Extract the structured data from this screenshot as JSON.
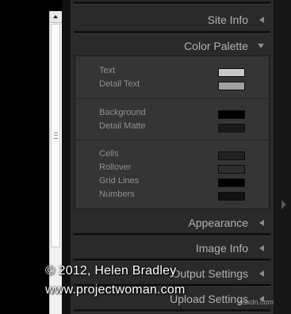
{
  "panel": {
    "headers": {
      "site_info": "Site Info",
      "color_palette": "Color Palette",
      "appearance": "Appearance",
      "image_info": "Image Info",
      "output_settings": "Output Settings",
      "upload_settings": "Upload Settings"
    },
    "colors": {
      "text": {
        "label": "Text",
        "color": "#c8c8c8"
      },
      "detail_text": {
        "label": "Detail Text",
        "color": "#a0a0a0"
      },
      "background": {
        "label": "Background",
        "color": "#000000"
      },
      "detail_matte": {
        "label": "Detail Matte",
        "color": "#1a1a1a"
      },
      "cells": {
        "label": "Cells",
        "color": "#222222"
      },
      "rollover": {
        "label": "Rollover",
        "color": "#2e2e2e"
      },
      "grid_lines": {
        "label": "Grid Lines",
        "color": "#000000"
      },
      "numbers": {
        "label": "Numbers",
        "color": "#111111"
      }
    }
  },
  "watermark": {
    "line1": "© 2012, Helen Bradley",
    "line2": "www.projectwoman.com",
    "corner": "wsxdn.com"
  },
  "icons": {
    "collapsed": "triangle-left-icon",
    "expanded": "triangle-down-icon",
    "scroll_up": "arrow-up-icon",
    "rail": "arrow-right-icon"
  }
}
